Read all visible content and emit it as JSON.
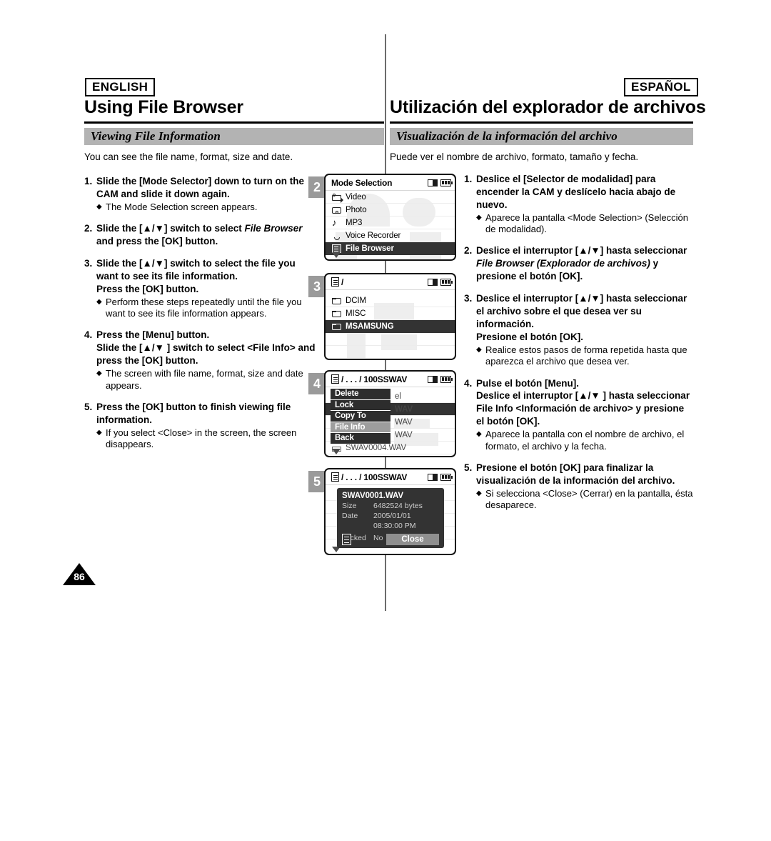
{
  "header": {
    "lang_en": "ENGLISH",
    "lang_es": "ESPAÑOL",
    "title_en": "Using File Browser",
    "title_es": "Utilización del explorador de archivos",
    "section_en": "Viewing File Information",
    "section_es": "Visualización de la información del archivo",
    "intro_en": "You can see the file name, format, size and date.",
    "intro_es": "Puede ver el nombre de archivo, formato, tamaño y fecha."
  },
  "english_steps": [
    {
      "num": "1.",
      "title": "Slide the [Mode Selector] down to turn on the CAM and slide it down again.",
      "bullets": [
        "The Mode Selection screen appears."
      ]
    },
    {
      "num": "2.",
      "title_pre": "Slide the [▲/▼] switch to select ",
      "title_em": "File Browser",
      "title_post": " and press the [OK] button.",
      "bullets": []
    },
    {
      "num": "3.",
      "title": "Slide the [▲/▼] switch to select the file you want to see its file information.",
      "title2": "Press the [OK] button.",
      "bullets": [
        "Perform these steps repeatedly until the file you want to see its file information appears."
      ]
    },
    {
      "num": "4.",
      "title": "Press the [Menu] button.",
      "title2": "Slide the [▲/▼ ] switch to select <File Info> and press the [OK] button.",
      "bullets": [
        "The screen with file name, format, size and date appears."
      ]
    },
    {
      "num": "5.",
      "title": "Press the [OK] button to finish viewing file information.",
      "bullets": [
        "If you select <Close> in the screen, the screen disappears."
      ]
    }
  ],
  "spanish_steps": [
    {
      "num": "1.",
      "title": "Deslice el [Selector de modalidad] para encender la CAM y deslícelo hacia abajo de nuevo.",
      "bullets": [
        "Aparece la pantalla <Mode Selection> (Selección de modalidad)."
      ]
    },
    {
      "num": "2.",
      "title_pre": "Deslice el interruptor [▲/▼] hasta seleccionar ",
      "title_em": "File Browser (Explorador de archivos)",
      "title_post": " y presione el botón [OK].",
      "bullets": []
    },
    {
      "num": "3.",
      "title": "Deslice el interruptor [▲/▼] hasta seleccionar el archivo sobre el que desea ver su información.",
      "title2": "Presione el botón [OK].",
      "bullets": [
        "Realice estos pasos de forma repetida hasta que aparezca el archivo que desea ver."
      ]
    },
    {
      "num": "4.",
      "title": "Pulse el botón [Menu].",
      "title2": "Deslice el interruptor [▲/▼ ] hasta seleccionar File Info <Información de archivo> y presione el botón [OK].",
      "bullets": [
        "Aparece la pantalla con el nombre de archivo, el formato, el archivo y la fecha."
      ]
    },
    {
      "num": "5.",
      "title": "Presione el botón [OK] para finalizar la visualización de la información del archivo.",
      "bullets": [
        "Si selecciona <Close> (Cerrar) en la pantalla, ésta desaparece."
      ]
    }
  ],
  "screens": {
    "s2": {
      "badge": "2",
      "title": "Mode Selection",
      "items": [
        {
          "label": "Video",
          "icon": "camcorder-icon",
          "selected": false
        },
        {
          "label": "Photo",
          "icon": "camera-icon",
          "selected": false
        },
        {
          "label": "MP3",
          "icon": "music-note-icon",
          "selected": false
        },
        {
          "label": "Voice Recorder",
          "icon": "microphone-icon",
          "selected": false
        },
        {
          "label": "File Browser",
          "icon": "document-icon",
          "selected": true
        }
      ]
    },
    "s3": {
      "badge": "3",
      "title": "/",
      "items": [
        {
          "label": "DCIM",
          "icon": "folder-icon",
          "selected": false
        },
        {
          "label": "MISC",
          "icon": "folder-icon",
          "selected": false
        },
        {
          "label": "MSAMSUNG",
          "icon": "folder-icon",
          "selected": true
        }
      ]
    },
    "s4": {
      "badge": "4",
      "title": "/ . . . / 100SSWAV",
      "menu": [
        {
          "label": "Delete",
          "highlighted": false
        },
        {
          "label": "Lock",
          "highlighted": false
        },
        {
          "label": "Copy To",
          "highlighted": false
        },
        {
          "label": "File Info",
          "highlighted": true
        },
        {
          "label": "Back",
          "highlighted": false
        }
      ],
      "files": [
        {
          "label": "el",
          "selected": false
        },
        {
          "label": "WAV",
          "selected": true
        },
        {
          "label": "WAV",
          "selected": false
        },
        {
          "label": "WAV",
          "selected": false
        },
        {
          "label": "SWAV0004.WAV",
          "selected": false
        }
      ]
    },
    "s5": {
      "badge": "5",
      "title": "/ . . . / 100SSWAV",
      "file_name": "SWAV0001.WAV",
      "rows": [
        {
          "key": "Size",
          "value": "6482524 bytes"
        },
        {
          "key": "Date",
          "value": "2005/01/01"
        },
        {
          "key": "",
          "value": "08:30:00 PM"
        },
        {
          "key": "Locked",
          "value": "No"
        }
      ],
      "close_label": "Close"
    }
  },
  "footer": {
    "page_number": "86"
  }
}
